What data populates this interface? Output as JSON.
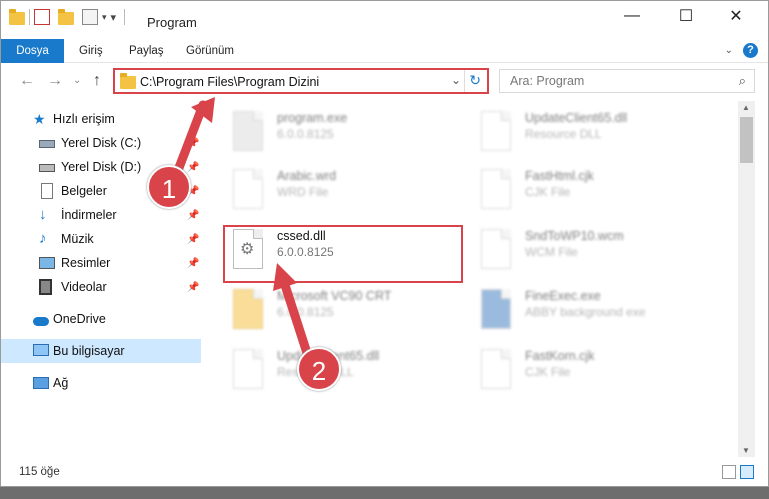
{
  "window": {
    "title": "Program",
    "minimize": "—",
    "maximize": "☐",
    "close": "✕"
  },
  "ribbon": {
    "tabs": [
      "Dosya",
      "Giriş",
      "Paylaş",
      "Görünüm"
    ],
    "expand_icon": "chevron-down-icon",
    "help_label": "?"
  },
  "nav": {
    "back": "←",
    "forward": "→",
    "recent": "⌄",
    "up": "↑",
    "address": "C:\\Program Files\\Program Dizini",
    "dropdown": "⌄",
    "refresh": "↻",
    "search_placeholder": "Ara: Program",
    "search_icon": "🔍"
  },
  "sidebar": {
    "items": [
      {
        "label": "Hızlı erişim",
        "icon": "star-icon"
      },
      {
        "label": "Yerel Disk (C:)",
        "icon": "drive-icon"
      },
      {
        "label": "Yerel Disk (D:)",
        "icon": "drive-icon"
      },
      {
        "label": "Belgeler",
        "icon": "documents-icon"
      },
      {
        "label": "İndirmeler",
        "icon": "download-icon"
      },
      {
        "label": "Müzik",
        "icon": "music-icon"
      },
      {
        "label": "Resimler",
        "icon": "pictures-icon"
      },
      {
        "label": "Videolar",
        "icon": "videos-icon"
      },
      {
        "label": "OneDrive",
        "icon": "cloud-icon"
      },
      {
        "label": "Bu bilgisayar",
        "icon": "computer-icon"
      },
      {
        "label": "Ağ",
        "icon": "network-icon"
      }
    ]
  },
  "files": [
    {
      "name": "program.exe",
      "sub": "6.0.0.8125"
    },
    {
      "name": "UpdateClient65.dll",
      "sub": "Resource DLL"
    },
    {
      "name": "Arabic.wrd",
      "sub": "WRD File"
    },
    {
      "name": "FastHtml.cjk",
      "sub": "CJK File"
    },
    {
      "name": "cssed.dll",
      "sub": "6.0.0.8125"
    },
    {
      "name": "SndToWP10.wcm",
      "sub": "WCM File"
    },
    {
      "name": "Microsoft VC90 CRT",
      "sub": "6.0.0.8125"
    },
    {
      "name": "FineExec.exe",
      "sub": "ABBY background exe"
    },
    {
      "name": "UpdateClient65.dll",
      "sub": "Resource DLL"
    },
    {
      "name": "FastKorn.cjk",
      "sub": "CJK File"
    }
  ],
  "callouts": [
    "1",
    "2"
  ],
  "status": {
    "count": "115 öğe"
  },
  "colors": {
    "accent": "#1979ca",
    "highlight": "#d9434a",
    "selection": "#cde8ff"
  }
}
